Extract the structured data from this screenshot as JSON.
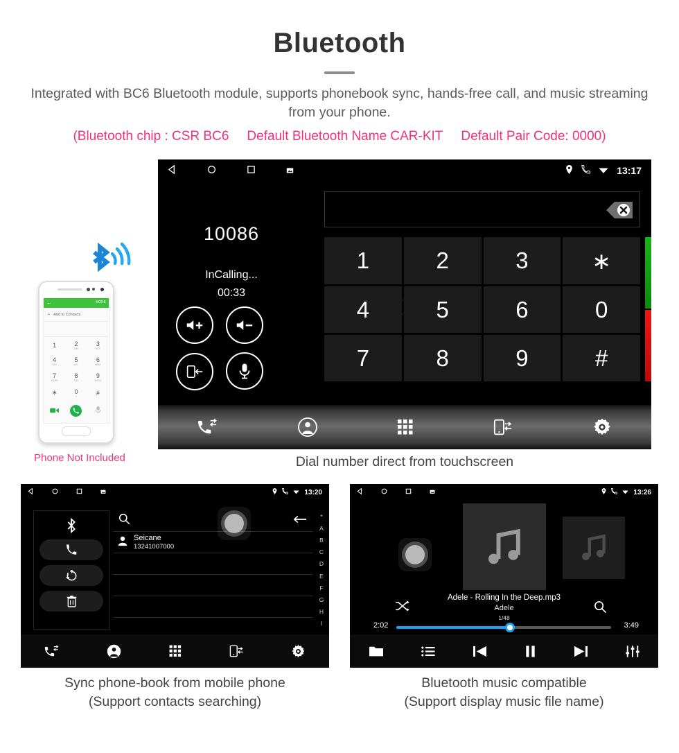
{
  "header": {
    "title": "Bluetooth",
    "subtitle": "Integrated with BC6 Bluetooth module, supports phonebook sync, hands-free call, and music streaming from your phone.",
    "spec_chip": "(Bluetooth chip : CSR BC6",
    "spec_name": "Default Bluetooth Name CAR-KIT",
    "spec_pair": "Default Pair Code: 0000)",
    "accent_color": "#f0327e",
    "text_color": "#5b5b5b"
  },
  "phone_mock": {
    "note": "Phone Not Included",
    "app_back": "←",
    "app_more": "MORE",
    "add_contacts": "Add to Contacts",
    "plus": "+",
    "keys": [
      {
        "digit": "1",
        "letters": ""
      },
      {
        "digit": "2",
        "letters": "ABC"
      },
      {
        "digit": "3",
        "letters": "DEF"
      },
      {
        "digit": "4",
        "letters": "GHI"
      },
      {
        "digit": "5",
        "letters": "JKL"
      },
      {
        "digit": "6",
        "letters": "MNO"
      },
      {
        "digit": "7",
        "letters": "PQRS"
      },
      {
        "digit": "8",
        "letters": "TUV"
      },
      {
        "digit": "9",
        "letters": "WXYZ"
      },
      {
        "digit": "∗",
        "letters": ""
      },
      {
        "digit": "0",
        "letters": "+"
      },
      {
        "digit": "#",
        "letters": ""
      }
    ]
  },
  "dial_screen": {
    "status_bar": {
      "time": "13:17",
      "nav_back": "back-icon",
      "nav_home": "home-icon",
      "nav_recents": "recents-icon",
      "nav_screenshot": "screenshot-icon",
      "location_icon": "location-pin-icon",
      "call_icon": "phone-handset-icon",
      "wifi_icon": "wifi-icon"
    },
    "number": "10086",
    "call_state": "InCalling...",
    "timer": "00:33",
    "input_value": "",
    "watermark": "Seicane",
    "controls": [
      {
        "name": "volume-up-button",
        "label": "volume-up-icon"
      },
      {
        "name": "volume-down-button",
        "label": "volume-down-icon"
      },
      {
        "name": "transfer-to-phone-button",
        "label": "phone-transfer-icon"
      },
      {
        "name": "mute-microphone-button",
        "label": "microphone-icon"
      }
    ],
    "keys": [
      "1",
      "2",
      "3",
      "∗",
      "4",
      "5",
      "6",
      "0",
      "7",
      "8",
      "9",
      "#"
    ],
    "call_button": "call-icon",
    "hangup_button": "hangup-icon",
    "backspace_button": "backspace-icon",
    "green": "#19b419",
    "red": "#f01414",
    "nav": [
      "call-log-icon",
      "contacts-icon",
      "dialpad-icon",
      "phone-sync-icon",
      "settings-gear-icon"
    ],
    "caption": "Dial number direct from touchscreen"
  },
  "phonebook_screen": {
    "status_bar": {
      "time": "13:20"
    },
    "side_buttons": [
      "bluetooth-icon",
      "call-icon",
      "sync-icon",
      "delete-icon"
    ],
    "search_placeholder": "",
    "search_icon": "search-icon",
    "back_icon": "back-arrow-icon",
    "contacts": [
      {
        "name": "Seicane",
        "number": "13241007000"
      }
    ],
    "alpha_index": [
      "*",
      "A",
      "B",
      "C",
      "D",
      "E",
      "F",
      "G",
      "H",
      "I"
    ],
    "nav": [
      "call-log-icon",
      "contacts-icon",
      "dialpad-icon",
      "phone-sync-icon",
      "settings-gear-icon"
    ],
    "caption_line1": "Sync phone-book from mobile phone",
    "caption_line2": "(Support contacts searching)"
  },
  "music_screen": {
    "status_bar": {
      "time": "13:26"
    },
    "track_title": "Adele - Rolling In the Deep.mp3",
    "artist": "Adele",
    "track_index": "1/48",
    "elapsed": "2:02",
    "duration": "3:49",
    "progress_percent": 53,
    "progress_color": "#1ba1f2",
    "shuffle_icon": "shuffle-icon",
    "search_icon": "search-icon",
    "controls": [
      "folder-icon",
      "playlist-icon",
      "previous-track-icon",
      "pause-icon",
      "next-track-icon",
      "equalizer-icon"
    ],
    "caption_line1": "Bluetooth music compatible",
    "caption_line2": "(Support display music file name)"
  }
}
